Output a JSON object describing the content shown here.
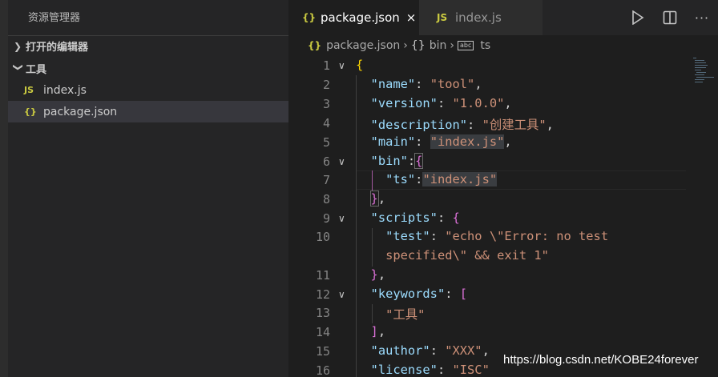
{
  "sidebar": {
    "title": "资源管理器",
    "sections": [
      {
        "label": "打开的编辑器",
        "expanded": false
      },
      {
        "label": "工具",
        "expanded": true
      }
    ],
    "files": [
      {
        "name": "index.js",
        "icon": "JS",
        "selected": false
      },
      {
        "name": "package.json",
        "icon": "{}",
        "selected": true
      }
    ]
  },
  "tabs": [
    {
      "label": "package.json",
      "icon": "{}",
      "active": true,
      "close": "×"
    },
    {
      "label": "index.js",
      "icon": "JS",
      "active": false
    }
  ],
  "breadcrumb": {
    "file": "package.json",
    "symbol1": "bin",
    "symbol2": "ts",
    "file_icon": "{}",
    "symbol1_icon": "{}",
    "symbol2_icon": "abc"
  },
  "editor": {
    "line_numbers": [
      "1",
      "2",
      "3",
      "4",
      "5",
      "6",
      "7",
      "8",
      "9",
      "10",
      "",
      "11",
      "12",
      "13",
      "14",
      "15",
      "16"
    ],
    "lines": {
      "name_key": "\"name\"",
      "name_val": "\"tool\"",
      "version_key": "\"version\"",
      "version_val": "\"1.0.0\"",
      "description_key": "\"description\"",
      "description_val": "\"创建工具\"",
      "main_key": "\"main\"",
      "main_val": "\"index.js\"",
      "bin_key": "\"bin\"",
      "ts_key": "\"ts\"",
      "ts_val": "\"index.js\"",
      "scripts_key": "\"scripts\"",
      "test_key": "\"test\"",
      "test_val_1": "\"echo \\\"Error: no test",
      "test_val_2": "specified\\\" && exit 1\"",
      "keywords_key": "\"keywords\"",
      "keyword_1": "\"工具\"",
      "author_key": "\"author\"",
      "author_val": "\"XXX\"",
      "license_key": "\"license\"",
      "license_val": "\"ISC\""
    }
  },
  "watermark": "https://blog.csdn.net/KOBE24forever",
  "colors": {
    "key": "#9cdcfe",
    "string": "#ce9178",
    "bracket_gold": "#ffd700",
    "bracket_purple": "#da70d6",
    "sidebar_bg": "#252526",
    "editor_bg": "#1e1e1e",
    "selected_row": "#37373d"
  }
}
